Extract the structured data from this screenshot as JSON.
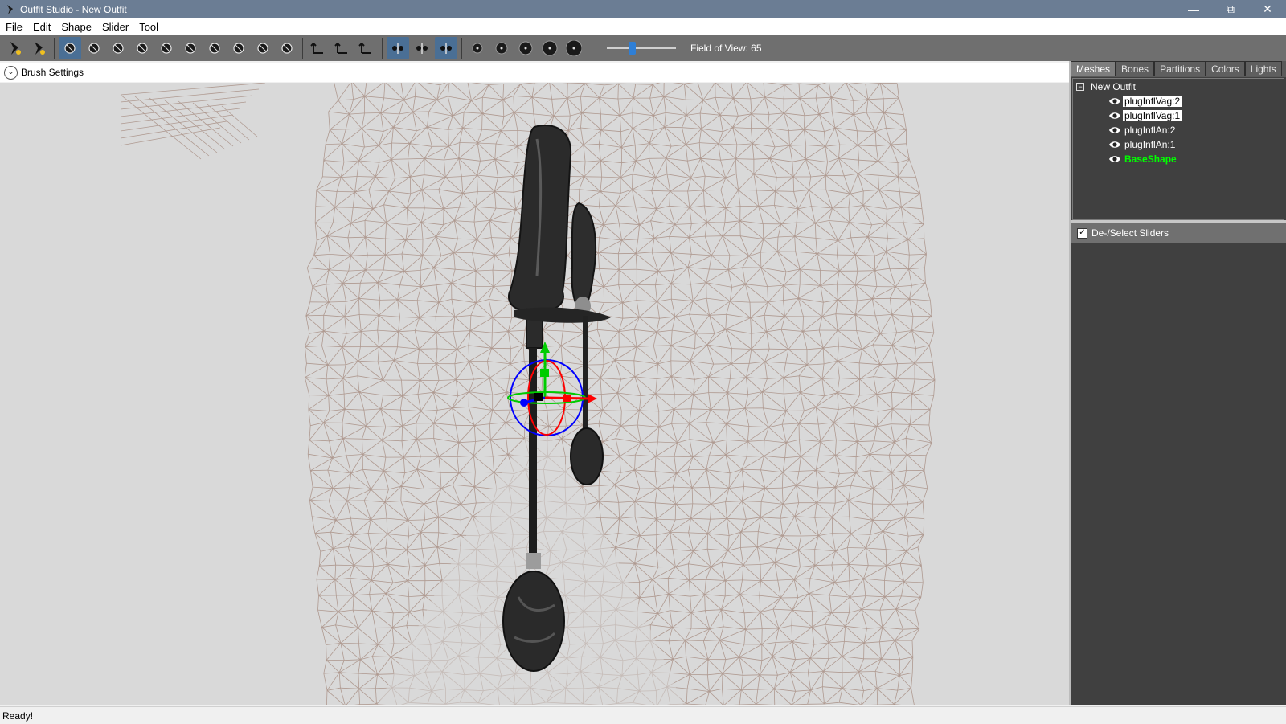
{
  "window": {
    "title": "Outfit Studio - New Outfit",
    "min_icon": "minimize-icon",
    "max_icon": "restore-icon",
    "close_icon": "close-icon"
  },
  "menu": [
    "File",
    "Edit",
    "Shape",
    "Slider",
    "Tool"
  ],
  "toolbar": {
    "groups": [
      [
        "new-project-icon",
        "load-outfit-icon"
      ],
      [
        "select-brush-icon",
        "mask-brush-icon",
        "inflate-brush-icon",
        "deflate-brush-icon",
        "move-brush-icon",
        "smooth-brush-icon",
        "undiff-brush-icon",
        "weight-brush-icon",
        "color-brush-icon",
        "alpha-brush-icon"
      ],
      [
        "transform-tool-icon",
        "pivot-tool-icon",
        "vertex-edit-icon"
      ],
      [
        "x-mirror-icon",
        "connected-only-icon",
        "global-brush-collision-icon"
      ],
      [
        "brush-size-small-icon",
        "brush-size-medium-icon",
        "brush-size-large-icon",
        "brush-size-xlarge-icon",
        "texture-view-icon"
      ]
    ],
    "active": [
      "select-brush-icon",
      "x-mirror-icon",
      "global-brush-collision-icon"
    ],
    "fov_label": "Field of View: 65",
    "fov_value": 65,
    "fov_min": 20,
    "fov_max": 150
  },
  "brush_settings": {
    "label": "Brush Settings"
  },
  "side_panel": {
    "tabs": [
      "Meshes",
      "Bones",
      "Partitions",
      "Colors",
      "Lights"
    ],
    "active_tab": "Meshes",
    "tree_root": "New Outfit",
    "meshes": [
      {
        "name": "plugInflVag:2",
        "selected": true
      },
      {
        "name": "plugInflVag:1",
        "selected": true
      },
      {
        "name": "plugInflAn:2",
        "selected": false
      },
      {
        "name": "plugInflAn:1",
        "selected": false
      },
      {
        "name": "BaseShape",
        "selected": false,
        "reference": true
      }
    ],
    "sliders_header": "De-/Select Sliders",
    "sliders_checked": true
  },
  "status": {
    "text": "Ready!"
  },
  "colors": {
    "wire": "#a88f84",
    "accent": "#4a6f95",
    "base_shape": "#00ff00",
    "gizmo_x": "#ff0000",
    "gizmo_y": "#00cc00",
    "gizmo_z": "#0000ff"
  }
}
